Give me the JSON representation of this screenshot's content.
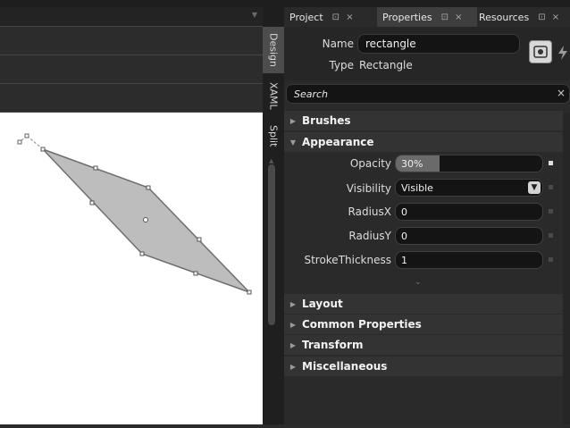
{
  "design_tabs": [
    "Design",
    "XAML",
    "Split"
  ],
  "panel_tabs": [
    {
      "label": "Project",
      "icons": "⊡ ×"
    },
    {
      "label": "Properties",
      "icons": "⊡ ×"
    },
    {
      "label": "Resources",
      "icons": "⊡ ×"
    }
  ],
  "header": {
    "name_label": "Name",
    "name_value": "rectangle",
    "type_label": "Type",
    "type_value": "Rectangle"
  },
  "search": {
    "placeholder": "Search",
    "clear": "×"
  },
  "sections": {
    "brushes": "Brushes",
    "appearance": "Appearance",
    "layout": "Layout",
    "common": "Common Properties",
    "transform": "Transform",
    "misc": "Miscellaneous"
  },
  "properties": {
    "opacity": {
      "label": "Opacity",
      "value": "30%",
      "level": 0.3
    },
    "visibility": {
      "label": "Visibility",
      "value": "Visible"
    },
    "radiusx": {
      "label": "RadiusX",
      "value": "0"
    },
    "radiusy": {
      "label": "RadiusY",
      "value": "0"
    },
    "stroke": {
      "label": "StrokeThickness",
      "value": "1"
    }
  },
  "icons": {
    "dropdown": "chevron-down-icon",
    "expand": "expand-more-icon",
    "view": "view-mode-icon",
    "events": "events-lightning-icon"
  }
}
